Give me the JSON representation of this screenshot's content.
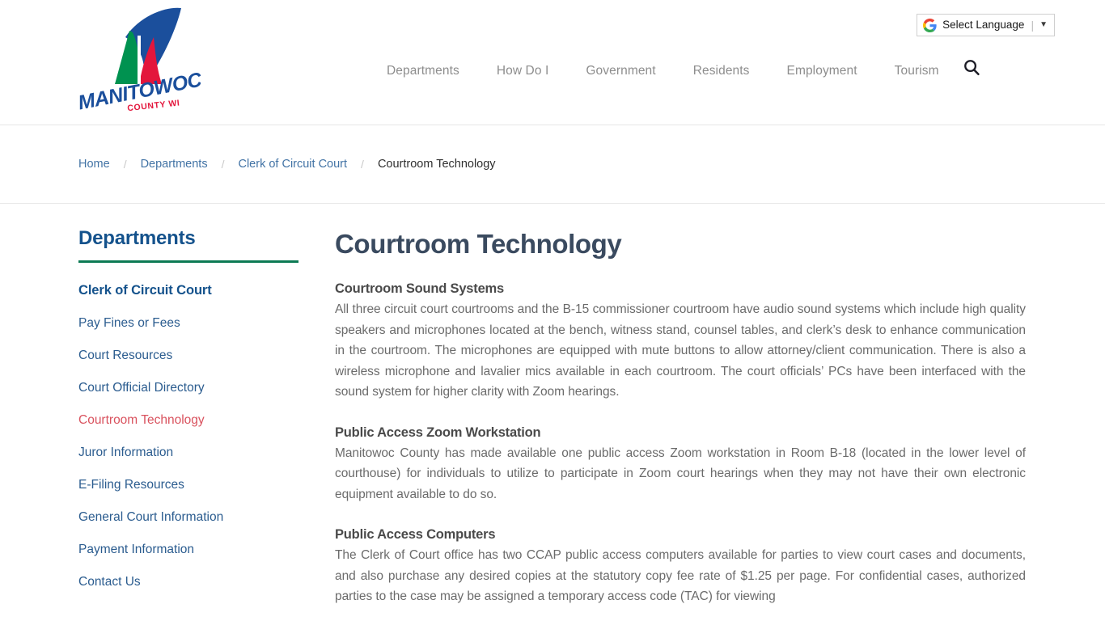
{
  "header": {
    "logo": {
      "name": "manitowoc-county-logo",
      "wordmark": "MANITOWOC",
      "subtitle": "COUNTY WI",
      "colors": {
        "blue": "#1b4f9c",
        "green": "#009250",
        "red": "#e3163c",
        "wordmark_blue": "#1b4f9c"
      }
    },
    "translate": {
      "label": "Select Language",
      "separator": "|",
      "caret": "▼",
      "icon": "google-g-icon"
    },
    "nav": [
      {
        "label": "Departments"
      },
      {
        "label": "How Do I"
      },
      {
        "label": "Government"
      },
      {
        "label": "Residents"
      },
      {
        "label": "Employment"
      },
      {
        "label": "Tourism"
      }
    ],
    "search_icon": "search-icon"
  },
  "breadcrumb": {
    "separator": "/",
    "items": [
      {
        "label": "Home",
        "current": false
      },
      {
        "label": "Departments",
        "current": false
      },
      {
        "label": "Clerk of Circuit Court",
        "current": false
      },
      {
        "label": "Courtroom Technology",
        "current": true
      }
    ]
  },
  "sidebar": {
    "title": "Departments",
    "rule_color": "#0c7a54",
    "section_heading": "Clerk of Circuit Court",
    "items": [
      {
        "label": "Pay Fines or Fees",
        "active": false
      },
      {
        "label": "Court Resources",
        "active": false
      },
      {
        "label": "Court Official Directory",
        "active": false
      },
      {
        "label": "Courtroom Technology",
        "active": true
      },
      {
        "label": "Juror Information",
        "active": false
      },
      {
        "label": "E-Filing Resources",
        "active": false
      },
      {
        "label": "General Court Information",
        "active": false
      },
      {
        "label": "Payment Information",
        "active": false
      },
      {
        "label": "Contact Us",
        "active": false
      }
    ],
    "active_color": "#d9525e"
  },
  "main": {
    "title": "Courtroom Technology",
    "sections": [
      {
        "heading": "Courtroom Sound Systems",
        "body": "All three circuit court courtrooms and the B-15 commissioner courtroom have audio sound systems which include high quality speakers and microphones located at the bench, witness stand, counsel tables, and clerk’s desk  to enhance communication in the courtroom.  The microphones are equipped with mute buttons to allow attorney/client communication.  There is also a wireless microphone and lavalier mics available in each courtroom.  The court officials’ PCs have been interfaced with the sound system for higher clarity with Zoom hearings."
      },
      {
        "heading": "Public Access Zoom Workstation",
        "body": "Manitowoc County has made available one public access Zoom workstation in Room B-18 (located in the lower level of courthouse) for individuals to utilize to participate in Zoom court hearings when they may not have their own electronic equipment available to do so."
      },
      {
        "heading": "Public Access Computers",
        "body": "The Clerk of Court office has two CCAP public access computers available for parties to view court cases and documents, and also purchase any desired copies at the statutory copy fee rate of $1.25 per page.  For confidential cases, authorized parties to the case may be assigned a temporary access code (TAC) for viewing"
      }
    ]
  }
}
